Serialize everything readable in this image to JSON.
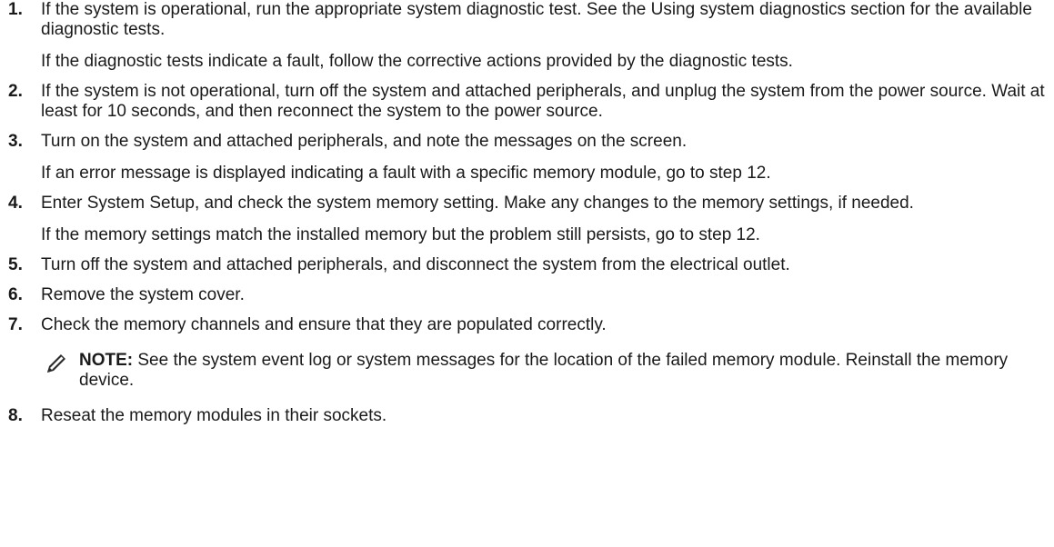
{
  "steps": [
    {
      "number": "1.",
      "paragraphs": [
        "If the system is operational, run the appropriate system diagnostic test. See the Using system diagnostics section for the available diagnostic tests.",
        "If the diagnostic tests indicate a fault, follow the corrective actions provided by the diagnostic tests."
      ]
    },
    {
      "number": "2.",
      "paragraphs": [
        "If the system is not operational, turn off the system and attached peripherals, and unplug the system from the power source. Wait at least for 10 seconds, and then reconnect the system to the power source."
      ]
    },
    {
      "number": "3.",
      "paragraphs": [
        "Turn on the system and attached peripherals, and note the messages on the screen.",
        "If an error message is displayed indicating a fault with a specific memory module, go to step 12."
      ]
    },
    {
      "number": "4.",
      "paragraphs": [
        "Enter System Setup, and check the system memory setting. Make any changes to the memory settings, if needed.",
        "If the memory settings match the installed memory but the problem still persists, go to step 12."
      ]
    },
    {
      "number": "5.",
      "paragraphs": [
        "Turn off the system and attached peripherals, and disconnect the system from the electrical outlet."
      ]
    },
    {
      "number": "6.",
      "paragraphs": [
        "Remove the system cover."
      ]
    },
    {
      "number": "7.",
      "paragraphs": [
        "Check the memory channels and ensure that they are populated correctly."
      ],
      "note": {
        "icon": "pencil-note-icon",
        "label": "NOTE:",
        "text": " See the system event log or system messages for the location of the failed memory module. Reinstall the memory device."
      }
    },
    {
      "number": "8.",
      "paragraphs": [
        "Reseat the memory modules in their sockets."
      ]
    }
  ]
}
